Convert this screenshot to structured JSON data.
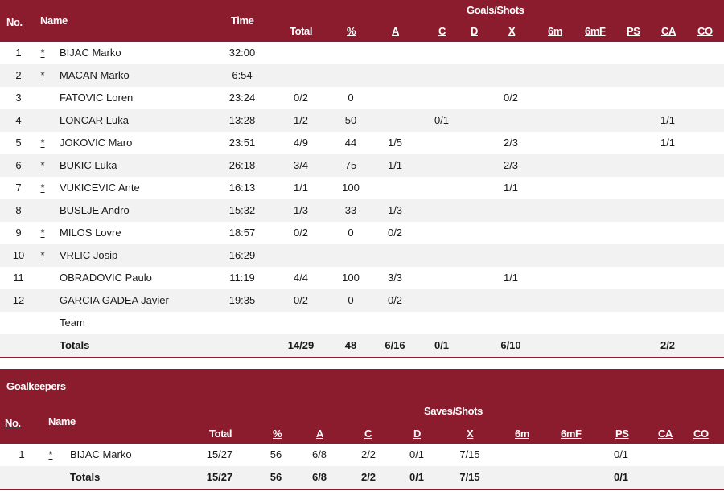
{
  "players_table": {
    "headers": {
      "no": "No.",
      "name": "Name",
      "time": "Time",
      "group": "Goals/Shots",
      "total": "Total",
      "pct": "%",
      "a": "A",
      "c": "C",
      "d": "D",
      "x": "X",
      "m6": "6m",
      "m6f": "6mF",
      "ps": "PS",
      "ca": "CA",
      "co": "CO"
    },
    "rows": [
      {
        "no": "1",
        "star": "*",
        "name": "BIJAC Marko",
        "time": "32:00",
        "total": "",
        "pct": "",
        "a": "",
        "c": "",
        "d": "",
        "x": "",
        "ps": "",
        "ca": ""
      },
      {
        "no": "2",
        "star": "*",
        "name": "MACAN Marko",
        "time": "6:54",
        "total": "",
        "pct": "",
        "a": "",
        "c": "",
        "d": "",
        "x": "",
        "ps": "",
        "ca": ""
      },
      {
        "no": "3",
        "star": "",
        "name": "FATOVIC Loren",
        "time": "23:24",
        "total": "0/2",
        "pct": "0",
        "a": "",
        "c": "",
        "d": "",
        "x": "0/2",
        "ps": "",
        "ca": ""
      },
      {
        "no": "4",
        "star": "",
        "name": "LONCAR Luka",
        "time": "13:28",
        "total": "1/2",
        "pct": "50",
        "a": "",
        "c": "0/1",
        "d": "",
        "x": "",
        "ps": "",
        "ca": "1/1"
      },
      {
        "no": "5",
        "star": "*",
        "name": "JOKOVIC Maro",
        "time": "23:51",
        "total": "4/9",
        "pct": "44",
        "a": "1/5",
        "c": "",
        "d": "",
        "x": "2/3",
        "ps": "",
        "ca": "1/1"
      },
      {
        "no": "6",
        "star": "*",
        "name": "BUKIC Luka",
        "time": "26:18",
        "total": "3/4",
        "pct": "75",
        "a": "1/1",
        "c": "",
        "d": "",
        "x": "2/3",
        "ps": "",
        "ca": ""
      },
      {
        "no": "7",
        "star": "*",
        "name": "VUKICEVIC Ante",
        "time": "16:13",
        "total": "1/1",
        "pct": "100",
        "a": "",
        "c": "",
        "d": "",
        "x": "1/1",
        "ps": "",
        "ca": ""
      },
      {
        "no": "8",
        "star": "",
        "name": "BUSLJE Andro",
        "time": "15:32",
        "total": "1/3",
        "pct": "33",
        "a": "1/3",
        "c": "",
        "d": "",
        "x": "",
        "ps": "",
        "ca": ""
      },
      {
        "no": "9",
        "star": "*",
        "name": "MILOS Lovre",
        "time": "18:57",
        "total": "0/2",
        "pct": "0",
        "a": "0/2",
        "c": "",
        "d": "",
        "x": "",
        "ps": "",
        "ca": ""
      },
      {
        "no": "10",
        "star": "*",
        "name": "VRLIC Josip",
        "time": "16:29",
        "total": "",
        "pct": "",
        "a": "",
        "c": "",
        "d": "",
        "x": "",
        "ps": "",
        "ca": ""
      },
      {
        "no": "11",
        "star": "",
        "name": "OBRADOVIC Paulo",
        "time": "11:19",
        "total": "4/4",
        "pct": "100",
        "a": "3/3",
        "c": "",
        "d": "",
        "x": "1/1",
        "ps": "",
        "ca": ""
      },
      {
        "no": "12",
        "star": "",
        "name": "GARCIA GADEA Javier",
        "time": "19:35",
        "total": "0/2",
        "pct": "0",
        "a": "0/2",
        "c": "",
        "d": "",
        "x": "",
        "ps": "",
        "ca": ""
      },
      {
        "no": "",
        "star": "",
        "name": "Team",
        "time": "",
        "total": "",
        "pct": "",
        "a": "",
        "c": "",
        "d": "",
        "x": "",
        "ps": "",
        "ca": ""
      }
    ],
    "totals": {
      "label": "Totals",
      "total": "14/29",
      "pct": "48",
      "a": "6/16",
      "c": "0/1",
      "x": "6/10",
      "ca": "2/2"
    }
  },
  "goalkeepers_table": {
    "title": "Goalkeepers",
    "headers": {
      "no": "No.",
      "name": "Name",
      "group": "Saves/Shots",
      "total": "Total",
      "pct": "%",
      "a": "A",
      "c": "C",
      "d": "D",
      "x": "X",
      "m6": "6m",
      "m6f": "6mF",
      "ps": "PS",
      "ca": "CA",
      "co": "CO"
    },
    "rows": [
      {
        "no": "1",
        "star": "*",
        "name": "BIJAC Marko",
        "total": "15/27",
        "pct": "56",
        "a": "6/8",
        "c": "2/2",
        "d": "0/1",
        "x": "7/15",
        "ps": "0/1"
      }
    ],
    "totals": {
      "label": "Totals",
      "total": "15/27",
      "pct": "56",
      "a": "6/8",
      "c": "2/2",
      "d": "0/1",
      "x": "7/15",
      "ps": "0/1"
    }
  },
  "colors": {
    "header_bg": "#8a1c2e",
    "header_text": "#ffffff",
    "alt_row": "#f2f2f2"
  }
}
